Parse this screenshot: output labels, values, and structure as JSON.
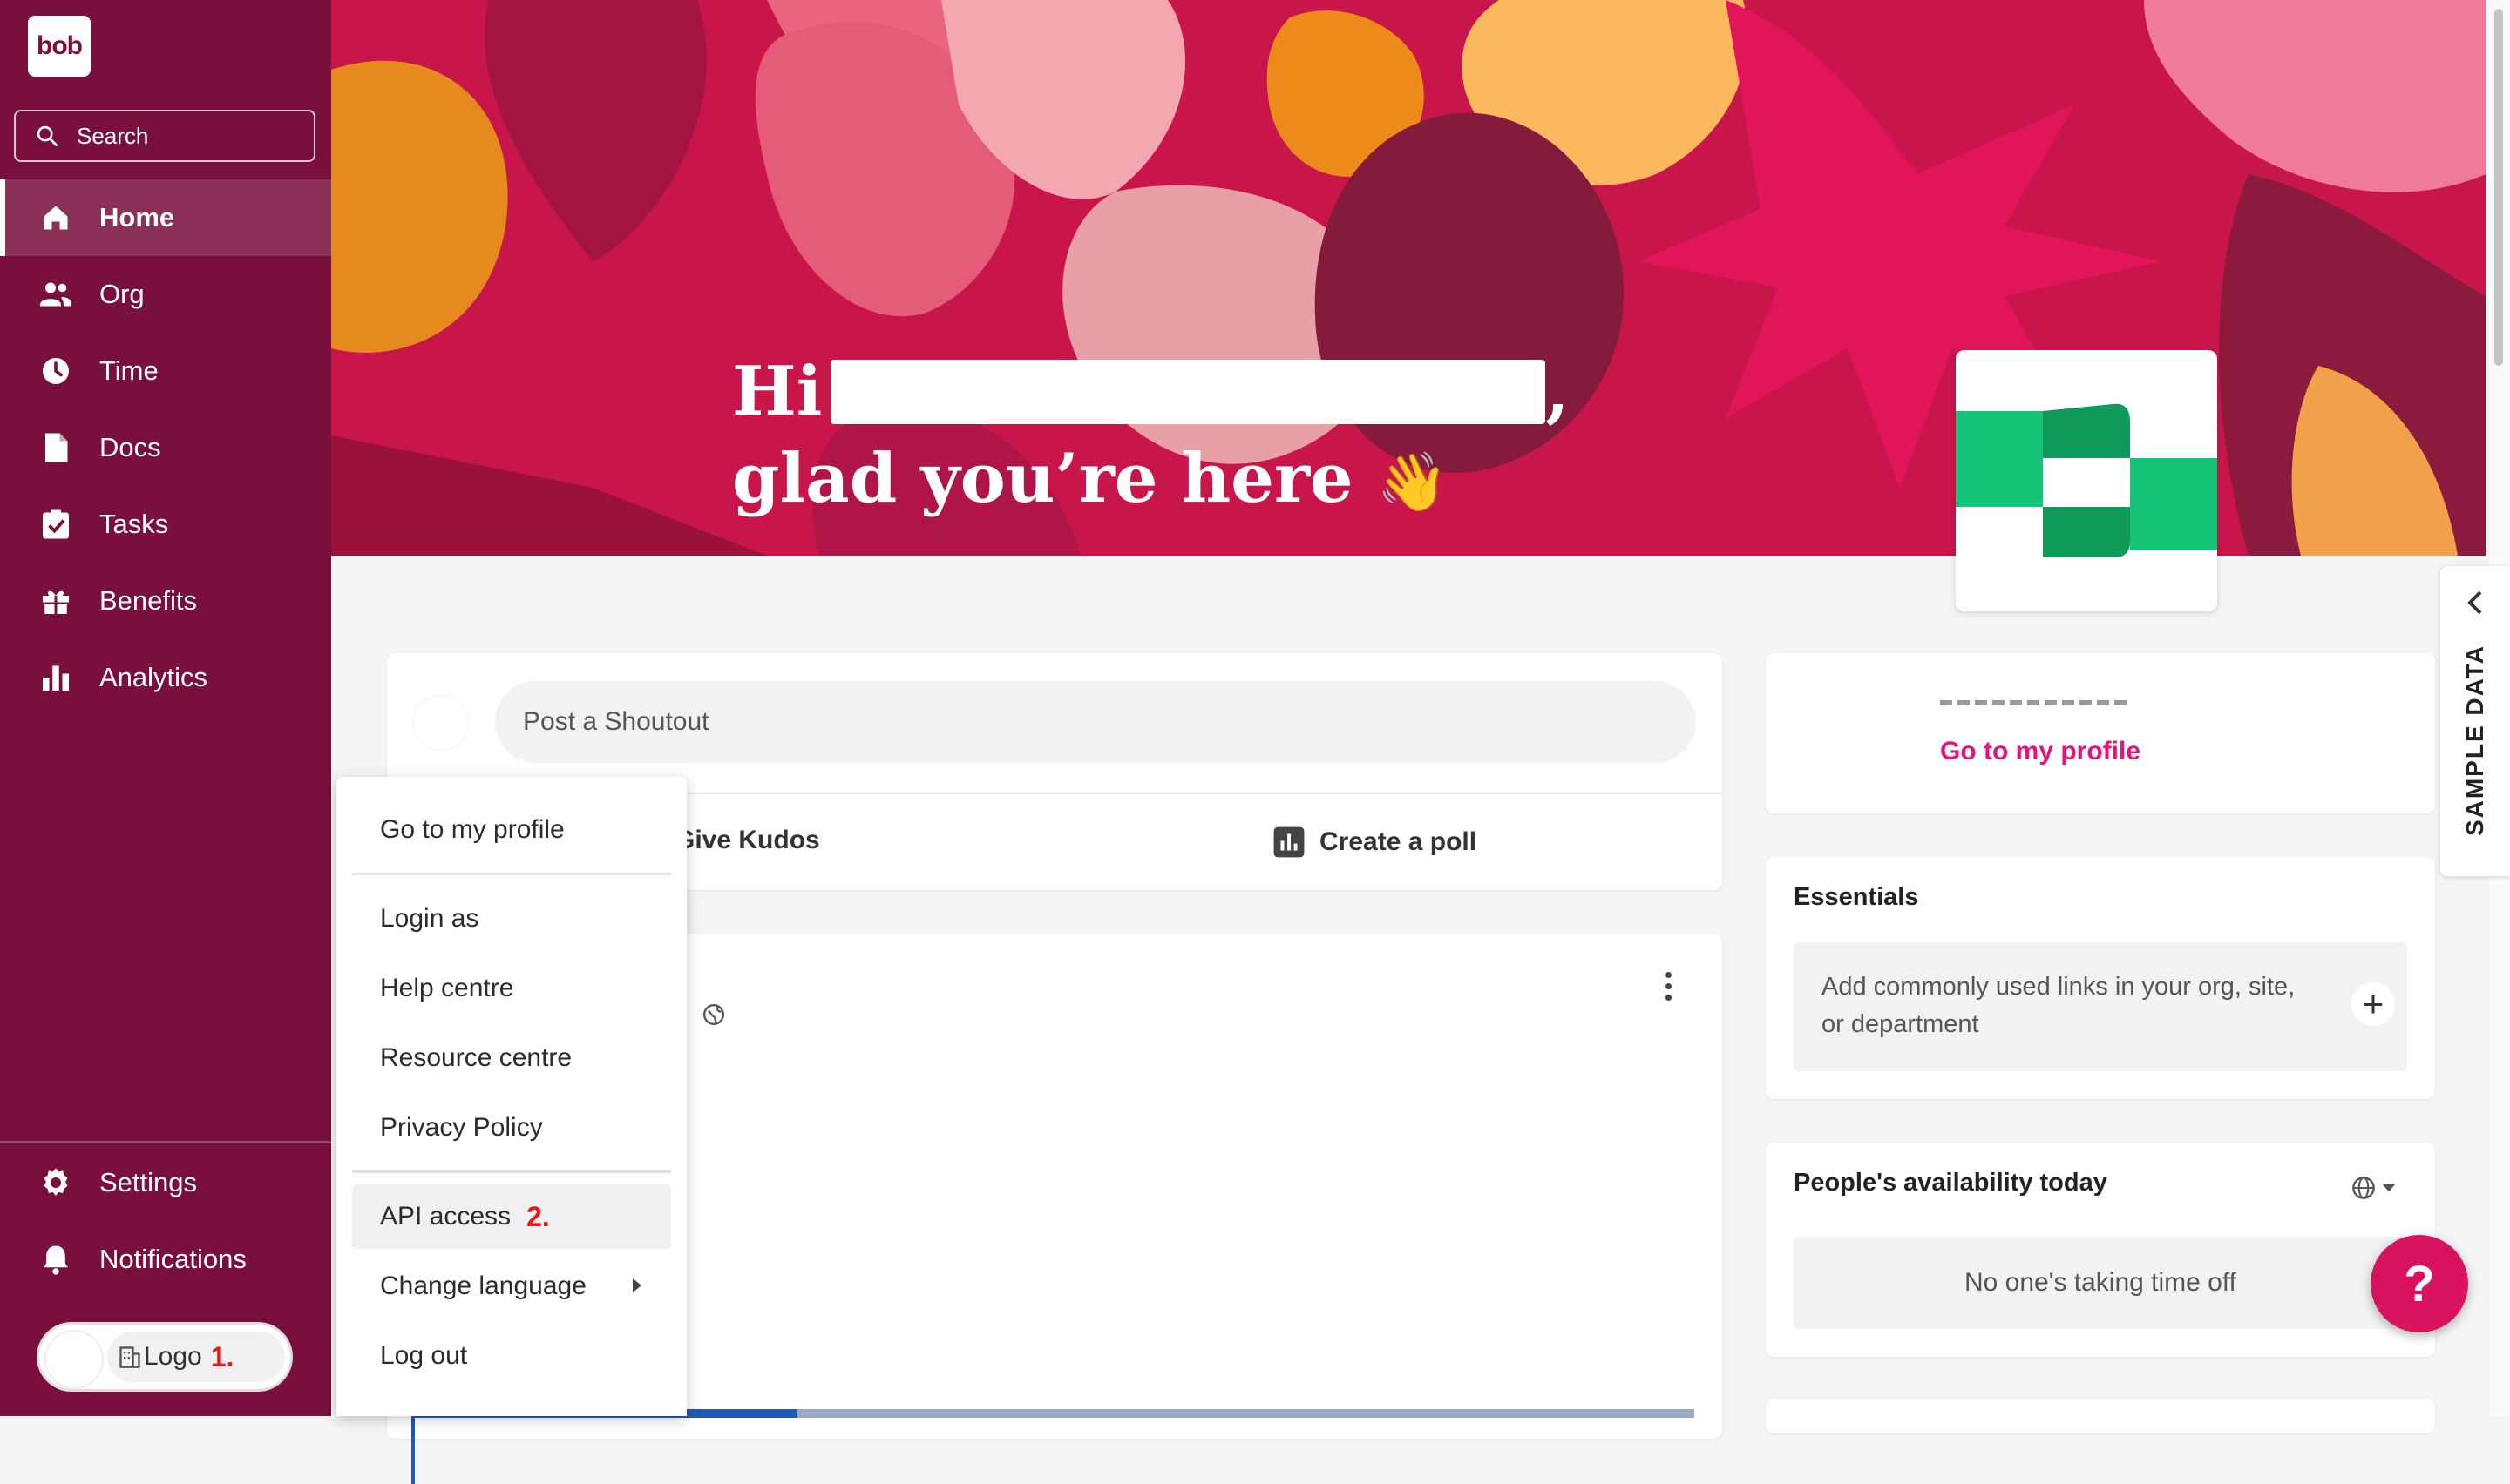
{
  "app": {
    "logo_text": "bob"
  },
  "sidebar": {
    "search_placeholder": "Search",
    "items": [
      {
        "label": "Home",
        "icon": "home-icon",
        "active": true
      },
      {
        "label": "Org",
        "icon": "people-icon"
      },
      {
        "label": "Time",
        "icon": "clock-icon"
      },
      {
        "label": "Docs",
        "icon": "document-icon"
      },
      {
        "label": "Tasks",
        "icon": "task-check-icon"
      },
      {
        "label": "Benefits",
        "icon": "gift-icon"
      },
      {
        "label": "Analytics",
        "icon": "bar-chart-icon"
      }
    ],
    "bottom_items": [
      {
        "label": "Settings",
        "icon": "gear-icon"
      },
      {
        "label": "Notifications",
        "icon": "bell-icon"
      }
    ],
    "user_pill": {
      "company_label": "Logo",
      "marker": "1."
    }
  },
  "banner": {
    "greeting_prefix": "Hi",
    "greeting_suffix": ",",
    "greeting_line2": "glad you’re here",
    "wave_emoji": "👋"
  },
  "sample_data_tab": {
    "label": "SAMPLE DATA"
  },
  "shoutout": {
    "placeholder": "Post a Shoutout",
    "actions": [
      {
        "label": "Give Kudos",
        "visible_label": "Give Kudos"
      },
      {
        "label": "Create a poll",
        "icon": "poll-icon"
      }
    ]
  },
  "profile_card": {
    "link": "Go to my profile"
  },
  "essentials": {
    "title": "Essentials",
    "empty_text": "Add commonly used links in your org, site, or department",
    "add_icon": "plus-icon"
  },
  "availability": {
    "title": "People's availability today",
    "empty_text": "No one's taking time off"
  },
  "help_button": {
    "label": "?"
  },
  "menu": {
    "items": [
      {
        "label": "Go to my profile"
      },
      {
        "label": "Login as"
      },
      {
        "label": "Help centre"
      },
      {
        "label": "Resource centre"
      },
      {
        "label": "Privacy Policy"
      },
      {
        "label": "API access",
        "marker": "2.",
        "highlighted": true
      },
      {
        "label": "Change language",
        "has_submenu": true
      },
      {
        "label": "Log out"
      }
    ]
  },
  "colors": {
    "sidebar": "#780f3c",
    "accent_pink": "#e6127c",
    "help_button": "#d8125e",
    "annotation_red": "#e41818"
  }
}
